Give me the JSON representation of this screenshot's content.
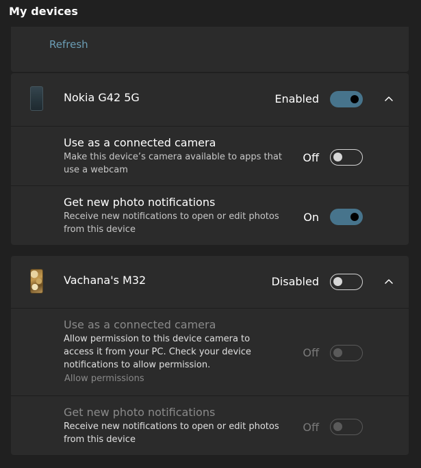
{
  "page": {
    "title": "My devices"
  },
  "refresh": {
    "label": "Refresh"
  },
  "devices": [
    {
      "name": "Nokia G42 5G",
      "status": "Enabled",
      "enabled": true,
      "icon": "phone-icon",
      "settings": [
        {
          "title": "Use as a connected camera",
          "description": "Make this device’s camera available to apps that use a webcam",
          "state_label": "Off",
          "on": false
        },
        {
          "title": "Get new photo notifications",
          "description": "Receive new notifications to open or edit photos from this device",
          "state_label": "On",
          "on": true
        }
      ]
    },
    {
      "name": "Vachana's M32",
      "status": "Disabled",
      "enabled": false,
      "icon": "phone-icon",
      "settings": [
        {
          "title": "Use as a connected camera",
          "description": "Allow permission to this device camera to access it from your PC. Check your device notifications to allow permission.",
          "link": "Allow permissions",
          "state_label": "Off",
          "on": false
        },
        {
          "title": "Get new photo notifications",
          "description": "Receive new notifications to open or edit photos from this device",
          "state_label": "Off",
          "on": false
        }
      ]
    }
  ],
  "colors": {
    "background": "#202020",
    "card": "#2b2b2b",
    "accent_toggle": "#47748c",
    "link": "#6c9fb7"
  }
}
